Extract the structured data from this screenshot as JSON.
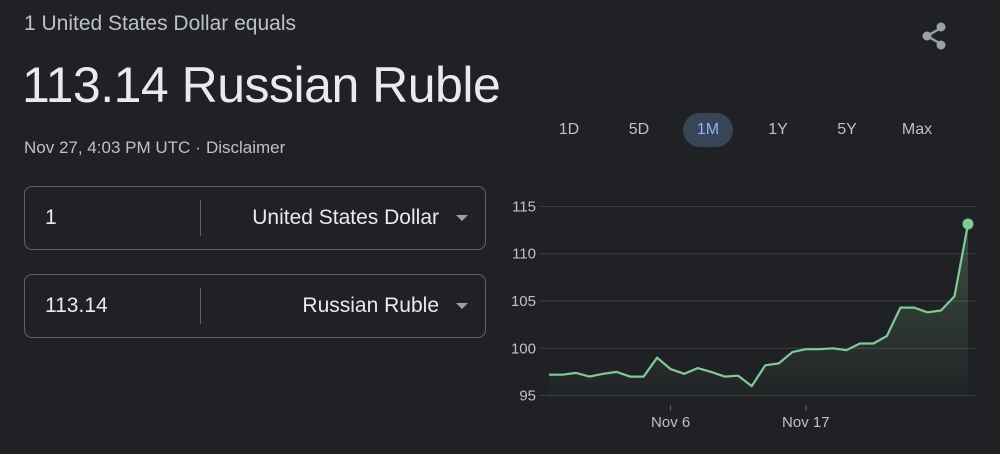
{
  "header": {
    "subtitle": "1 United States Dollar equals",
    "result": "113.14 Russian Ruble",
    "timestamp": "Nov 27, 4:03 PM UTC",
    "separator": "·",
    "disclaimer": "Disclaimer",
    "share_icon": "share-icon"
  },
  "converter": {
    "from": {
      "amount": "1",
      "currency": "United States Dollar"
    },
    "to": {
      "amount": "113.14",
      "currency": "Russian Ruble"
    }
  },
  "range_tabs": {
    "items": [
      "1D",
      "5D",
      "1M",
      "1Y",
      "5Y",
      "Max"
    ],
    "selected": "1M"
  },
  "colors": {
    "background": "#202124",
    "line": "#81c995",
    "active_tab_bg": "#394457",
    "active_tab_text": "#8ab4f8"
  },
  "chart_data": {
    "type": "area",
    "ylim": [
      94,
      116
    ],
    "yticks": [
      95,
      100,
      105,
      110,
      115
    ],
    "xtick_labels": [
      {
        "label": "Nov 6",
        "index": 9
      },
      {
        "label": "Nov 17",
        "index": 19
      }
    ],
    "values": [
      97.2,
      97.2,
      97.4,
      97.0,
      97.3,
      97.5,
      97.0,
      97.0,
      99.0,
      97.8,
      97.3,
      97.9,
      97.5,
      97.0,
      97.1,
      96.0,
      98.2,
      98.4,
      99.6,
      99.9,
      99.9,
      100.0,
      99.8,
      100.5,
      100.5,
      101.3,
      104.3,
      104.3,
      103.8,
      104.0,
      105.5,
      113.14
    ],
    "last_value": 113.14
  }
}
